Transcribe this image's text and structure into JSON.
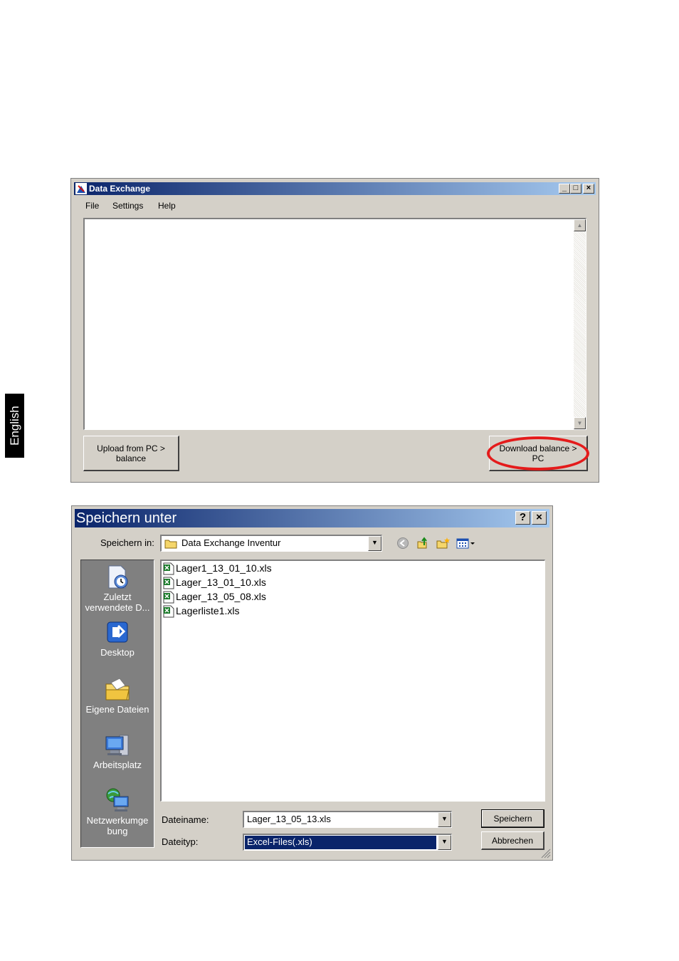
{
  "side_tab": {
    "label": "English"
  },
  "data_exchange": {
    "title": "Data Exchange",
    "window_buttons": {
      "minimize": "_",
      "maximize": "□",
      "close": "×"
    },
    "menu": [
      "File",
      "Settings",
      "Help"
    ],
    "upload_button": [
      "Upload from PC >",
      "balance"
    ],
    "download_button": [
      "Download balance >",
      "PC"
    ],
    "highlight_color": "#e41b1b"
  },
  "save_dialog": {
    "title": "Speichern unter",
    "help_button": "?",
    "close_button": "×",
    "save_in_label": "Speichern in:",
    "save_in_value": "Data Exchange Inventur",
    "places": [
      {
        "icon": "recent-documents-icon",
        "label": [
          "Zuletzt",
          "verwendete D..."
        ]
      },
      {
        "icon": "desktop-icon",
        "label": [
          "Desktop"
        ]
      },
      {
        "icon": "my-documents-icon",
        "label": [
          "Eigene Dateien"
        ]
      },
      {
        "icon": "my-computer-icon",
        "label": [
          "Arbeitsplatz"
        ]
      },
      {
        "icon": "network-icon",
        "label": [
          "Netzwerkumge",
          "bung"
        ]
      }
    ],
    "files": [
      "Lager1_13_01_10.xls",
      "Lager_13_01_10.xls",
      "Lager_13_05_08.xls",
      "Lagerliste1.xls"
    ],
    "filename_label": "Dateiname:",
    "filename_value": "Lager_13_05_13.xls",
    "filetype_label": "Dateityp:",
    "filetype_value": "Excel-Files(.xls)",
    "save_button": "Speichern",
    "cancel_button": "Abbrechen"
  }
}
